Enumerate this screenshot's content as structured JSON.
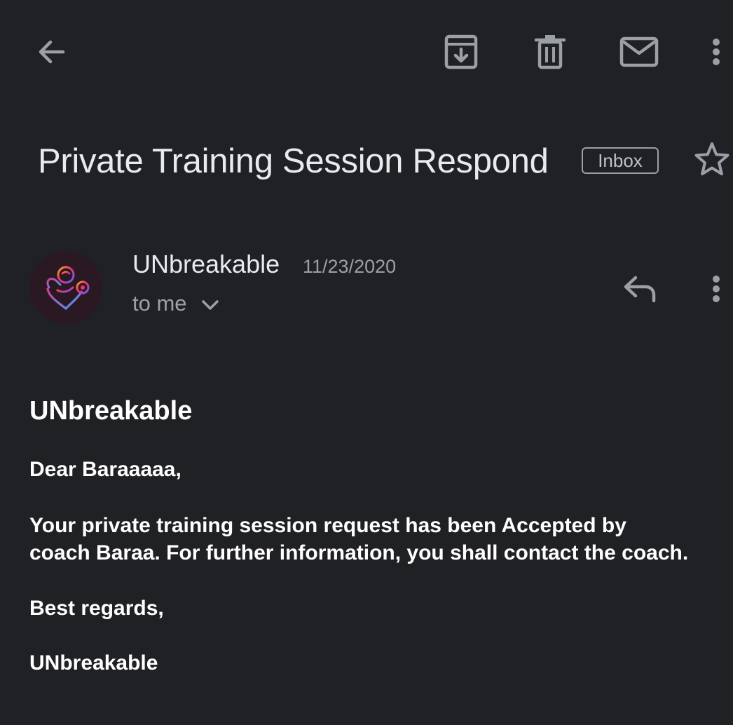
{
  "toolbar": {
    "back_icon": "arrow-back-icon",
    "archive_icon": "archive-icon",
    "delete_icon": "trash-icon",
    "mark_unread_icon": "mail-icon",
    "more_icon": "more-vert-icon"
  },
  "email": {
    "subject": "Private Training Session Respond",
    "label": "Inbox",
    "starred": false,
    "sender": {
      "name": "UNbreakable",
      "date": "11/23/2020",
      "recipient": "to me"
    },
    "body": {
      "heading": "UNbreakable",
      "greeting": "Dear Baraaaaa,",
      "paragraph_line1": "Your private training session request has been Accepted by",
      "paragraph_line2": "coach Baraa. For further information, you shall contact the coach.",
      "closing": "Best regards,",
      "signature": "UNbreakable"
    }
  },
  "colors": {
    "background": "#202124",
    "primary_text": "#e8eaed",
    "secondary_text": "#9aa0a6",
    "icon": "#9aa0a6",
    "avatar_bg": "#2a1823"
  }
}
